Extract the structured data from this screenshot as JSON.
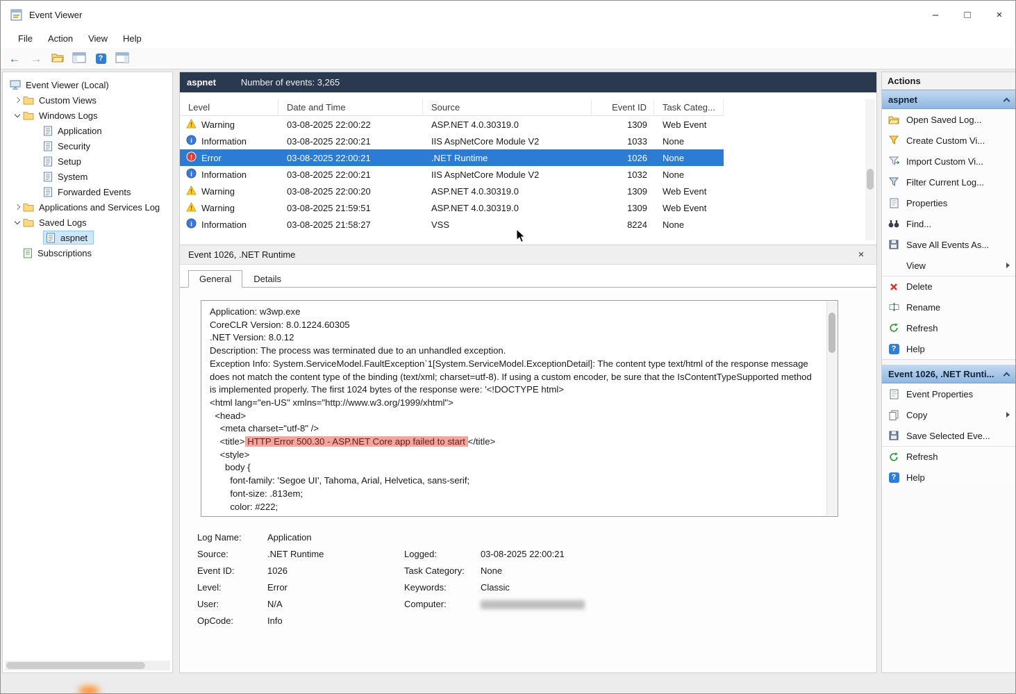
{
  "window": {
    "title": "Event Viewer",
    "controls": {
      "minimize": "–",
      "maximize": "□",
      "close": "×"
    }
  },
  "menu": {
    "items": [
      "File",
      "Action",
      "View",
      "Help"
    ]
  },
  "tree": {
    "items": [
      {
        "label": "Event Viewer (Local)"
      },
      {
        "label": "Custom Views"
      },
      {
        "label": "Windows Logs"
      },
      {
        "label": "Application"
      },
      {
        "label": "Security"
      },
      {
        "label": "Setup"
      },
      {
        "label": "System"
      },
      {
        "label": "Forwarded Events"
      },
      {
        "label": "Applications and Services Log"
      },
      {
        "label": "Saved Logs"
      },
      {
        "label": "aspnet"
      },
      {
        "label": "Subscriptions"
      }
    ]
  },
  "list": {
    "log_name": "aspnet",
    "count_text": "Number of events: 3,265",
    "columns": [
      "Level",
      "Date and Time",
      "Source",
      "Event ID",
      "Task Categ..."
    ],
    "rows": [
      {
        "level": "Warning",
        "datetime": "03-08-2025 22:00:22",
        "source": "ASP.NET 4.0.30319.0",
        "event_id": "1309",
        "task": "Web Event"
      },
      {
        "level": "Information",
        "datetime": "03-08-2025 22:00:21",
        "source": "IIS AspNetCore Module V2",
        "event_id": "1033",
        "task": "None"
      },
      {
        "level": "Error",
        "datetime": "03-08-2025 22:00:21",
        "source": ".NET Runtime",
        "event_id": "1026",
        "task": "None"
      },
      {
        "level": "Information",
        "datetime": "03-08-2025 22:00:21",
        "source": "IIS AspNetCore Module V2",
        "event_id": "1032",
        "task": "None"
      },
      {
        "level": "Warning",
        "datetime": "03-08-2025 22:00:20",
        "source": "ASP.NET 4.0.30319.0",
        "event_id": "1309",
        "task": "Web Event"
      },
      {
        "level": "Warning",
        "datetime": "03-08-2025 21:59:51",
        "source": "ASP.NET 4.0.30319.0",
        "event_id": "1309",
        "task": "Web Event"
      },
      {
        "level": "Information",
        "datetime": "03-08-2025 21:58:27",
        "source": "VSS",
        "event_id": "8224",
        "task": "None"
      }
    ]
  },
  "detail": {
    "title": "Event 1026, .NET Runtime",
    "close": "×",
    "tabs": [
      "General",
      "Details"
    ],
    "lines": [
      "Application: w3wp.exe",
      "CoreCLR Version: 8.0.1224.60305",
      ".NET Version: 8.0.12",
      "Description: The process was terminated due to an unhandled exception.",
      "Exception Info: System.ServiceModel.FaultException`1[System.ServiceModel.ExceptionDetail]: The content type text/html of the response message does not match the content type of the binding (text/xml; charset=utf-8). If using a custom encoder, be sure that the IsContentTypeSupported method is implemented properly. The first 1024 bytes of the response were: '<!DOCTYPE html>",
      "<html lang=\"en-US\" xmlns=\"http://www.w3.org/1999/xhtml\">",
      "  <head>",
      "    <meta charset=\"utf-8\" />",
      "    <style>",
      "      body {",
      "        font-family: 'Segoe UI', Tahoma, Arial, Helvetica, sans-serif;",
      "        font-size: .813em;",
      "        color: #222;"
    ],
    "title_line": {
      "prefix": "    <title>",
      "highlight": " HTTP Error 500.30 - ASP.NET Core app failed to start ",
      "suffix": "</title>"
    },
    "fields": {
      "log_name_label": "Log Name:",
      "log_name": "Application",
      "source_label": "Source:",
      "source": ".NET Runtime",
      "logged_label": "Logged:",
      "logged": "03-08-2025 22:00:21",
      "event_id_label": "Event ID:",
      "event_id": "1026",
      "task_label": "Task Category:",
      "task": "None",
      "level_label": "Level:",
      "level": "Error",
      "keywords_label": "Keywords:",
      "keywords": "Classic",
      "user_label": "User:",
      "user": "N/A",
      "computer_label": "Computer:",
      "opcode_label": "OpCode:",
      "opcode": "Info"
    }
  },
  "actions": {
    "title": "Actions",
    "sections": [
      {
        "header": "aspnet",
        "items": [
          {
            "label": "Open Saved Log..."
          },
          {
            "label": "Create Custom Vi..."
          },
          {
            "label": "Import Custom Vi..."
          },
          {
            "label": "Filter Current Log..."
          },
          {
            "label": "Properties"
          },
          {
            "label": "Find..."
          },
          {
            "label": "Save All Events As..."
          },
          {
            "label": "View"
          },
          {
            "label": "Delete"
          },
          {
            "label": "Rename"
          },
          {
            "label": "Refresh"
          },
          {
            "label": "Help"
          }
        ]
      },
      {
        "header": "Event 1026, .NET Runti...",
        "items": [
          {
            "label": "Event Properties"
          },
          {
            "label": "Copy"
          },
          {
            "label": "Save Selected Eve..."
          },
          {
            "label": "Refresh"
          },
          {
            "label": "Help"
          }
        ]
      }
    ]
  }
}
